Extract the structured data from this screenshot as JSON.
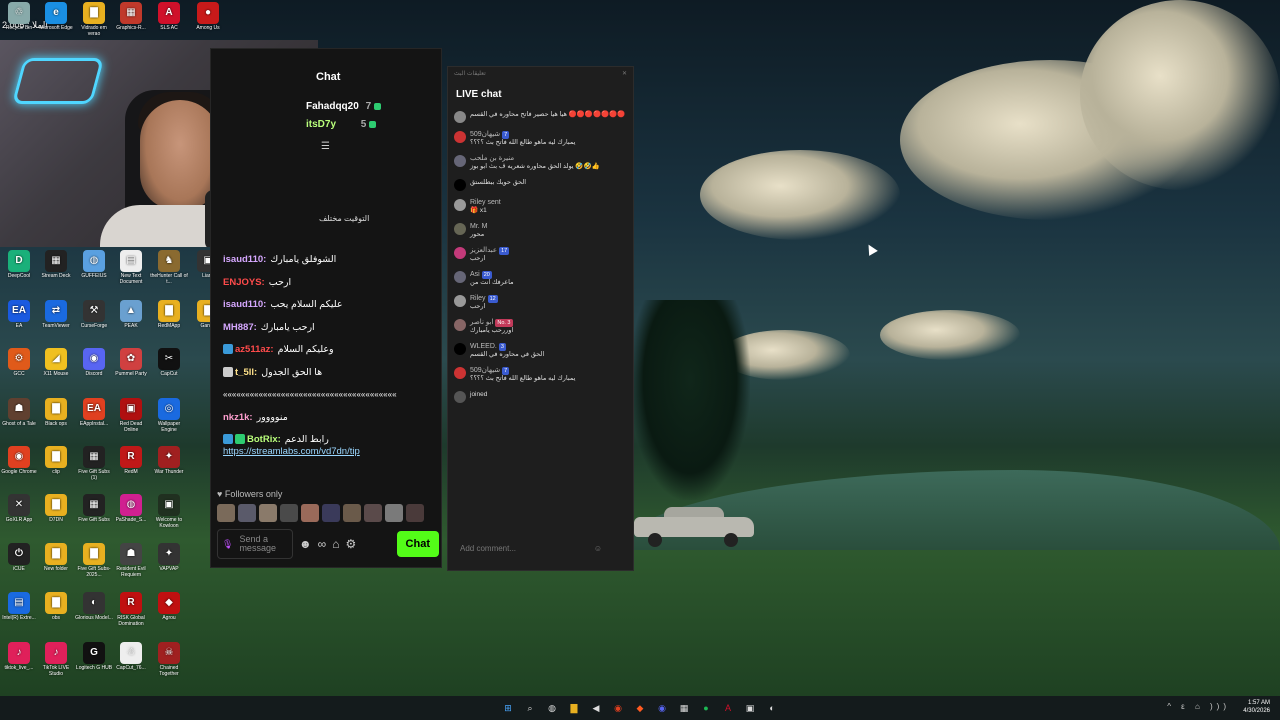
{
  "top_overlay_text": "2.005 : الملا",
  "desktop_icons": [
    {
      "label": "Recycle Bin",
      "color": "#8aa",
      "glyph": "♲"
    },
    {
      "label": "Microsoft Edge",
      "color": "#1a8fe3",
      "glyph": "e"
    },
    {
      "label": "Vidrado em verao",
      "color": "#e8b020",
      "glyph": "▇"
    },
    {
      "label": "Graphics-R...",
      "color": "#c0392b",
      "glyph": "▦"
    },
    {
      "label": "SLS AC",
      "color": "#d0102a",
      "glyph": "A"
    },
    {
      "label": "Among Us",
      "color": "#c81a1a",
      "glyph": "●"
    },
    {
      "label": "DeepCool",
      "color": "#1ab07a",
      "glyph": "D"
    },
    {
      "label": "Stream Deck",
      "color": "#222",
      "glyph": "▦"
    },
    {
      "label": "GUFFEIUS",
      "color": "#5aa0e0",
      "glyph": "◍"
    },
    {
      "label": "New Text Document",
      "color": "#eee",
      "glyph": "▤"
    },
    {
      "label": "theHunter Call of t...",
      "color": "#8a6a30",
      "glyph": "♞"
    },
    {
      "label": "Liar's",
      "color": "#333",
      "glyph": "▣"
    },
    {
      "label": "EA",
      "color": "#1a5ae0",
      "glyph": "EA"
    },
    {
      "label": "TeamViewer",
      "color": "#1a6ae0",
      "glyph": "⇄"
    },
    {
      "label": "CurseForge",
      "color": "#333",
      "glyph": "⚒"
    },
    {
      "label": "PEAK",
      "color": "#6aa0d0",
      "glyph": "▲"
    },
    {
      "label": "RedMApp",
      "color": "#e8b020",
      "glyph": "▇"
    },
    {
      "label": "Ganga",
      "color": "#e8b020",
      "glyph": "▇"
    },
    {
      "label": "GCC",
      "color": "#e05a1a",
      "glyph": "⚙"
    },
    {
      "label": "X11 Mouse",
      "color": "#f0c020",
      "glyph": "◢"
    },
    {
      "label": "Discord",
      "color": "#5865f2",
      "glyph": "◉"
    },
    {
      "label": "Pummel Party",
      "color": "#d04040",
      "glyph": "✿"
    },
    {
      "label": "CapCut",
      "color": "#111",
      "glyph": "✂"
    },
    {
      "label": "Ghost of a Tale",
      "color": "#604030",
      "glyph": "☗"
    },
    {
      "label": "Black ops",
      "color": "#e8b020",
      "glyph": "▇"
    },
    {
      "label": "EAppInstal...",
      "color": "#e04020",
      "glyph": "EA"
    },
    {
      "label": "Red Dead Online",
      "color": "#b01010",
      "glyph": "▣"
    },
    {
      "label": "Wallpaper Engine",
      "color": "#1a6ae0",
      "glyph": "◎"
    },
    {
      "label": "Google Chrome",
      "color": "#e04020",
      "glyph": "◉"
    },
    {
      "label": "clip",
      "color": "#e8b020",
      "glyph": "▇"
    },
    {
      "label": "Five Gift Subs (1)",
      "color": "#222",
      "glyph": "▦"
    },
    {
      "label": "RedM",
      "color": "#c01818",
      "glyph": "R"
    },
    {
      "label": "War Thunder",
      "color": "#a02020",
      "glyph": "✦"
    },
    {
      "label": "GoXLR App",
      "color": "#333",
      "glyph": "✕"
    },
    {
      "label": "D7DN",
      "color": "#e8b020",
      "glyph": "▇"
    },
    {
      "label": "Five Gift Subs",
      "color": "#222",
      "glyph": "▦"
    },
    {
      "label": "PaShade_S...",
      "color": "#d02090",
      "glyph": "◍"
    },
    {
      "label": "Welcome to Kowloon",
      "color": "#203020",
      "glyph": "▣"
    },
    {
      "label": "iCUE",
      "color": "#222",
      "glyph": "⏻"
    },
    {
      "label": "New folder",
      "color": "#e8b020",
      "glyph": "▇"
    },
    {
      "label": "Five Gift Subs-2025...",
      "color": "#e8b020",
      "glyph": "▇"
    },
    {
      "label": "Resident Evil Requiem",
      "color": "#444",
      "glyph": "☗"
    },
    {
      "label": "VAPVAP",
      "color": "#333",
      "glyph": "✦"
    },
    {
      "label": "Intel(R) Extre...",
      "color": "#1a6ae0",
      "glyph": "▤"
    },
    {
      "label": "obs",
      "color": "#e8b020",
      "glyph": "▇"
    },
    {
      "label": "Glorious Model...",
      "color": "#333",
      "glyph": "◐"
    },
    {
      "label": "RISK Global Domination",
      "color": "#c01010",
      "glyph": "R"
    },
    {
      "label": "Agrou",
      "color": "#c01010",
      "glyph": "◆"
    },
    {
      "label": "tiktok_live_...",
      "color": "#e0205a",
      "glyph": "♪"
    },
    {
      "label": "TikTok LIVE Studio",
      "color": "#e0205a",
      "glyph": "♪"
    },
    {
      "label": "Logitech G HUB",
      "color": "#111",
      "glyph": "G"
    },
    {
      "label": "CapCut_76...",
      "color": "#eee",
      "glyph": "☃"
    },
    {
      "label": "Chained Together",
      "color": "#a02020",
      "glyph": "☠"
    }
  ],
  "chat": {
    "title": "Chat",
    "leaderboard": [
      {
        "name": "Fahadqq20",
        "count": "7"
      },
      {
        "name": "itsD7y",
        "count": "5"
      }
    ],
    "partial_note": "التوقيت مختلف",
    "messages": [
      {
        "user": "isaud110:",
        "text": "الشوفلق يامبارك",
        "style": ""
      },
      {
        "user": "ENJOYS:",
        "text": "ارحب",
        "style": "red"
      },
      {
        "user": "isaud110:",
        "text": "عليكم السلام يحب",
        "style": ""
      },
      {
        "user": "MH887:",
        "text": "ارحب يامبارك",
        "style": ""
      },
      {
        "user": "az511az:",
        "text": "وعليكم السلام",
        "style": "red"
      },
      {
        "user": "t_5ll:",
        "text": "ها الحق الجدول",
        "style": "yel"
      },
      {
        "user": "",
        "text": "«««««««««««««««««««««««««««««««««««««««",
        "style": ""
      },
      {
        "user": "nkz1k:",
        "text": "منوووور",
        "style": "pink"
      },
      {
        "user": "BotRix:",
        "text": "رابط الدعم",
        "style": "green",
        "link": "https://streamlabs.com/vd7dn/tip"
      }
    ],
    "followers_only": "Followers only",
    "input_placeholder": "Send a message",
    "chat_button": "Chat"
  },
  "live": {
    "titlebar": "تعليقات البث",
    "title": "LIVE chat",
    "messages": [
      {
        "name": "",
        "tag": "",
        "text": "هيا هيا حصير فاتح محاوره في القسم 🔴🔴🔴🔴🔴🔴🔴"
      },
      {
        "name": "509شيهان",
        "tag": "7",
        "text": "يمبارك ليه ماهو طالع الله فاتح بث ؟؟؟؟"
      },
      {
        "name": "منيرة بن ملحب",
        "tag": "",
        "text": "يولد الحق محاوره شعريه ف بث ابو بوز 🤣🤣👍"
      },
      {
        "name": "",
        "tag": "",
        "text": "الحق حويك ببطلستق"
      },
      {
        "name": "Riley sent",
        "tag": "",
        "text": "🎁 x1"
      },
      {
        "name": "Mr. M",
        "tag": "",
        "text": "محور"
      },
      {
        "name": "عبدالعزيز",
        "tag": "17",
        "text": "ارحب"
      },
      {
        "name": "Asi",
        "tag": "20",
        "text": "ماعرفك انت من"
      },
      {
        "name": "Riley",
        "tag": "12",
        "text": "ارحب"
      },
      {
        "name": "ابو ناصر",
        "tag": "No. 3",
        "text": "اوررحب يامبارك"
      },
      {
        "name": "WLEED.",
        "tag": "3",
        "text": "الحق في محاوره في القسم"
      },
      {
        "name": "509شيهان",
        "tag": "7",
        "text": "يمبارك ليه ماهو طالع الله فاتح بث ؟؟؟؟"
      },
      {
        "name": "",
        "tag": "",
        "text": "joined"
      }
    ],
    "comment_placeholder": "Add comment..."
  },
  "taskbar": {
    "time": "1:57 AM",
    "date": "4/30/2026",
    "tray": "^ ε ⌂ ))) "
  }
}
